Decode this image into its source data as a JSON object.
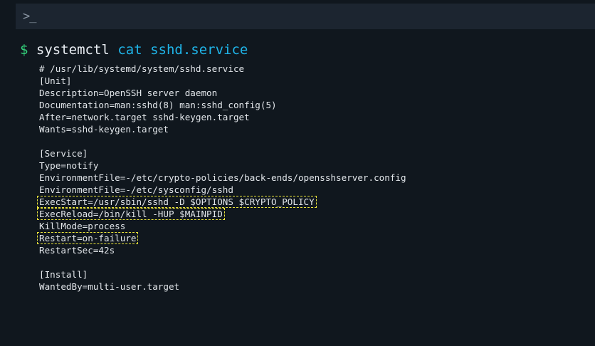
{
  "tab_bar": {
    "prompt_icon": ">_"
  },
  "command": {
    "prompt_symbol": "$",
    "program": "systemctl",
    "arguments": "cat sshd.service"
  },
  "output_lines": [
    "# /usr/lib/systemd/system/sshd.service",
    "[Unit]",
    "Description=OpenSSH server daemon",
    "Documentation=man:sshd(8) man:sshd_config(5)",
    "After=network.target sshd-keygen.target",
    "Wants=sshd-keygen.target",
    "",
    "[Service]",
    "Type=notify",
    "EnvironmentFile=-/etc/crypto-policies/back-ends/opensshserver.config",
    "EnvironmentFile=-/etc/sysconfig/sshd",
    "ExecStart=/usr/sbin/sshd -D $OPTIONS $CRYPTO_POLICY",
    "ExecReload=/bin/kill -HUP $MAINPID",
    "KillMode=process",
    "Restart=on-failure",
    "RestartSec=42s",
    "",
    "[Install]",
    "WantedBy=multi-user.target"
  ],
  "highlighted_lines": [
    11,
    12,
    14
  ],
  "colors": {
    "background": "#10171e",
    "tab_bar": "#1c2530",
    "prompt": "#34d17b",
    "command": "#e8edf2",
    "argument": "#1fb4e8",
    "output_text": "#e2e6ea",
    "highlight_border": "#e8e23a"
  }
}
